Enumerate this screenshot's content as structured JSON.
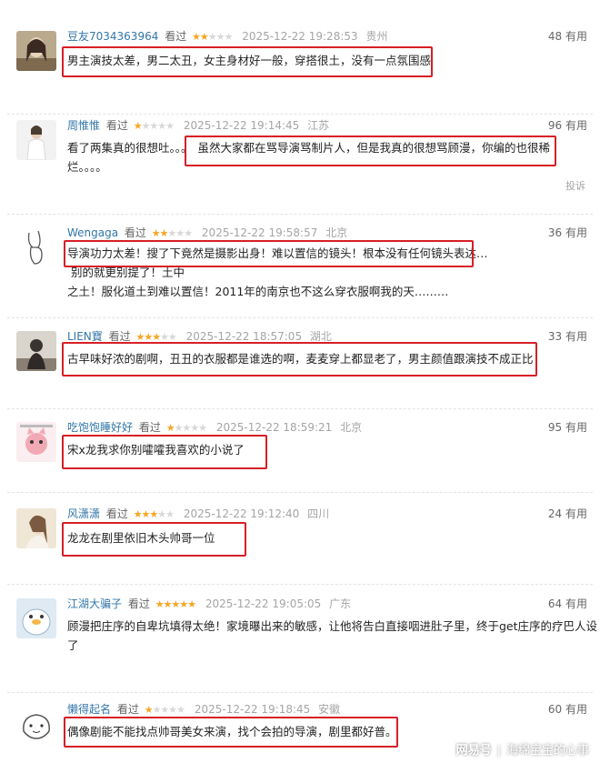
{
  "watched_label": "看过",
  "useful_suffix": "有用",
  "report_label": "投诉",
  "watermark": {
    "brand": "网易号",
    "separator": "|",
    "account": "海绵宝宝的心事"
  },
  "colors": {
    "username": "#3377aa",
    "star_on": "#f5a623",
    "star_off": "#d8d8d8",
    "highlight_box": "#d61f26"
  },
  "comments": [
    {
      "username": "豆友7034363964",
      "rating": 2,
      "time": "2025-12-22 19:28:53",
      "location": "贵州",
      "useful": 48,
      "text": "男主演技太差，男二太丑，女主身材好一般，穿搭很土，没有一点氛围感",
      "avatar": "photo-girl"
    },
    {
      "username": "周惟惟",
      "rating": 1,
      "time": "2025-12-22 19:14:45",
      "location": "江苏",
      "useful": 96,
      "text_line1_a": "看了两集真的很想吐。。。",
      "text_line1_b": "虽然大家都在骂导演骂制片人，但是我真的很想骂顾漫，你编的也很稀",
      "text_line2": "烂。。。。",
      "avatar": "photo-white-dress"
    },
    {
      "username": "Wengaga",
      "rating": 2,
      "time": "2025-12-22 19:58:57",
      "location": "北京",
      "useful": 36,
      "text_line1_a": "导演功力太差！搜了下竟然是摄影出身！难以置信的镜头！根本没有任何镜头表达…",
      "text_line1_b": "别的就更别提了！土中",
      "text_line2": "之土！服化道土到难以置信！2011年的南京也不这么穿衣服啊我的天………",
      "avatar": "rabbit-sketch"
    },
    {
      "username": "LIEN寶",
      "rating": 3,
      "time": "2025-12-22 18:57:05",
      "location": "湖北",
      "useful": 33,
      "text": "古早味好浓的剧啊，丑丑的衣服都是谁选的啊，麦麦穿上都显老了，男主颜值跟演技不成正比",
      "avatar": "photo-person"
    },
    {
      "username": "吃饱饱睡好好",
      "rating": 1,
      "time": "2025-12-22 18:59:21",
      "location": "北京",
      "useful": 95,
      "text": "宋x龙我求你别嚯嚯我喜欢的小说了",
      "avatar": "cartoon-cat"
    },
    {
      "username": "风潇潇",
      "rating": 3,
      "time": "2025-12-22 19:12:40",
      "location": "四川",
      "useful": 24,
      "text": "龙龙在剧里依旧木头帅哥一位",
      "avatar": "photo-portrait"
    },
    {
      "username": "江湖大骗子",
      "rating": 5,
      "time": "2025-12-22 19:05:05",
      "location": "广东",
      "useful": 64,
      "text_line1": "顾漫把庄序的自卑坑填得太绝！家境曝出来的敏感，让他将告白直接咽进肚子里，终于get庄序的疗巴人设",
      "text_line2": "了",
      "avatar": "penguin-cartoon"
    },
    {
      "username": "懒得起名",
      "rating": 1,
      "time": "2025-12-22 19:18:45",
      "location": "安徽",
      "useful": 60,
      "text": "偶像剧能不能找点帅哥美女来演，找个会拍的导演，剧里都好普。",
      "avatar": "cartoon-face"
    }
  ]
}
